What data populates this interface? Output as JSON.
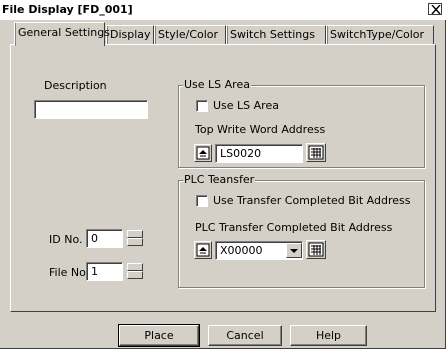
{
  "window": {
    "title": "File Display [FD_001]",
    "close_icon": "close-icon"
  },
  "tabs": [
    {
      "label": "General Settings",
      "active": true
    },
    {
      "label": "Display",
      "active": false
    },
    {
      "label": "Style/Color",
      "active": false
    },
    {
      "label": "Switch Settings",
      "active": false
    },
    {
      "label": "SwitchType/Color",
      "active": false
    }
  ],
  "general": {
    "description_label": "Description",
    "description_value": "",
    "id_label": "ID No.",
    "id_value": "0",
    "file_label": "File No.",
    "file_value": "1"
  },
  "ls_area": {
    "group_title": "Use LS Area",
    "checkbox_label": "Use LS Area",
    "checked": false,
    "address_label": "Top Write Word Address",
    "address_value": "LS0020"
  },
  "plc_transfer": {
    "group_title": "PLC Teansfer",
    "checkbox_label": "Use Transfer Completed Bit Address",
    "checked": false,
    "address_label": "PLC Transfer Completed Bit Address",
    "address_value": "X00000"
  },
  "buttons": {
    "place": "Place",
    "cancel": "Cancel",
    "help": "Help"
  }
}
